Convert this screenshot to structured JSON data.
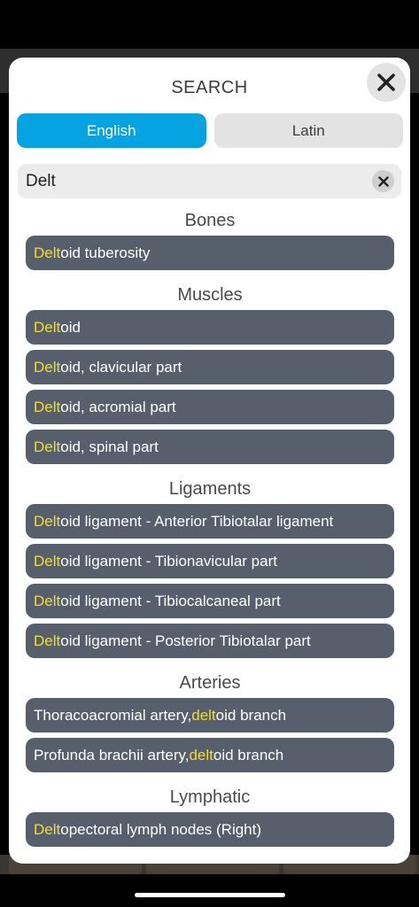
{
  "modal": {
    "title": "SEARCH",
    "close_icon": "close-icon"
  },
  "language_tabs": [
    {
      "label": "English",
      "active": true
    },
    {
      "label": "Latin",
      "active": false
    }
  ],
  "search": {
    "value": "Delt",
    "clear_icon": "clear-icon"
  },
  "colors": {
    "accent": "#06a3e2",
    "result_bg": "#565f6b",
    "highlight": "#f2dc33"
  },
  "sections": [
    {
      "heading": "Bones",
      "items": [
        {
          "before": "",
          "match": "Delt",
          "after": "oid tuberosity"
        }
      ]
    },
    {
      "heading": "Muscles",
      "items": [
        {
          "before": "",
          "match": "Delt",
          "after": "oid"
        },
        {
          "before": "",
          "match": "Delt",
          "after": "oid, clavicular part"
        },
        {
          "before": "",
          "match": "Delt",
          "after": "oid, acromial part"
        },
        {
          "before": "",
          "match": "Delt",
          "after": "oid, spinal part"
        }
      ]
    },
    {
      "heading": "Ligaments",
      "items": [
        {
          "before": "",
          "match": "Delt",
          "after": "oid ligament - Anterior Tibiotalar ligament"
        },
        {
          "before": "",
          "match": "Delt",
          "after": "oid ligament - Tibionavicular part"
        },
        {
          "before": "",
          "match": "Delt",
          "after": "oid ligament - Tibiocalcaneal part"
        },
        {
          "before": "",
          "match": "Delt",
          "after": "oid ligament - Posterior Tibiotalar part"
        }
      ]
    },
    {
      "heading": "Arteries",
      "items": [
        {
          "before": "Thoracoacromial artery, ",
          "match": "delt",
          "after": "oid branch"
        },
        {
          "before": "Profunda brachii artery, ",
          "match": "delt",
          "after": "oid branch"
        }
      ]
    },
    {
      "heading": "Lymphatic",
      "items": [
        {
          "before": "",
          "match": "Delt",
          "after": "opectoral lymph nodes (Right)"
        }
      ]
    }
  ]
}
